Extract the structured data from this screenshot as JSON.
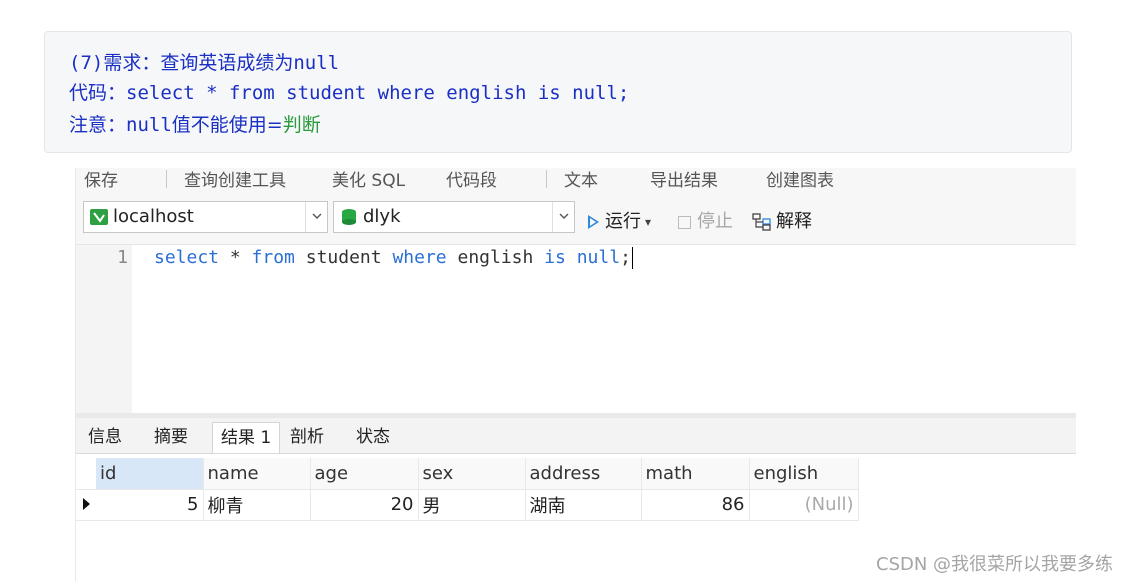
{
  "note": {
    "line1_prefix": "(7)",
    "line1_text": "需求：查询英语成绩为",
    "line1_code": "null",
    "line2_label": "代码：",
    "line2_code": "select * from student where english is null;",
    "line3_label": "注意：",
    "line3_code": "null",
    "line3_text": "值不能使用",
    "line3_eq": "=",
    "line3_green": "判断"
  },
  "toolbar_top": {
    "items": [
      "保存",
      "查询创建工具",
      "美化 SQL",
      "代码段",
      "文本",
      "导出结果",
      "创建图表"
    ]
  },
  "selectors": {
    "connection": "localhost",
    "database": "dlyk"
  },
  "actions": {
    "run_label": "运行",
    "stop_label": "停止",
    "explain_label": "解释"
  },
  "editor": {
    "line_number": "1",
    "tokens": {
      "kw_select": "select",
      "star": " * ",
      "kw_from": "from",
      "table": " student ",
      "kw_where": "where",
      "column": " english ",
      "kw_is": "is",
      "space": " ",
      "kw_null": "null",
      "semi": ";"
    }
  },
  "result_tabs": [
    "信息",
    "摘要",
    "结果 1",
    "剖析",
    "状态"
  ],
  "active_tab_index": 2,
  "grid": {
    "columns": [
      "id",
      "name",
      "age",
      "sex",
      "address",
      "math",
      "english"
    ],
    "rows": [
      [
        "5",
        "柳青",
        "20",
        "男",
        "湖南",
        "86",
        "(Null)"
      ]
    ]
  },
  "watermark": "CSDN @我很菜所以我要多练",
  "colors": {
    "note_blue": "#1a2fc4",
    "note_green": "#2a9b3c",
    "sql_keyword": "#2a6fd4",
    "run_accent": "#2d89dc",
    "connection_green": "#2ea043"
  }
}
